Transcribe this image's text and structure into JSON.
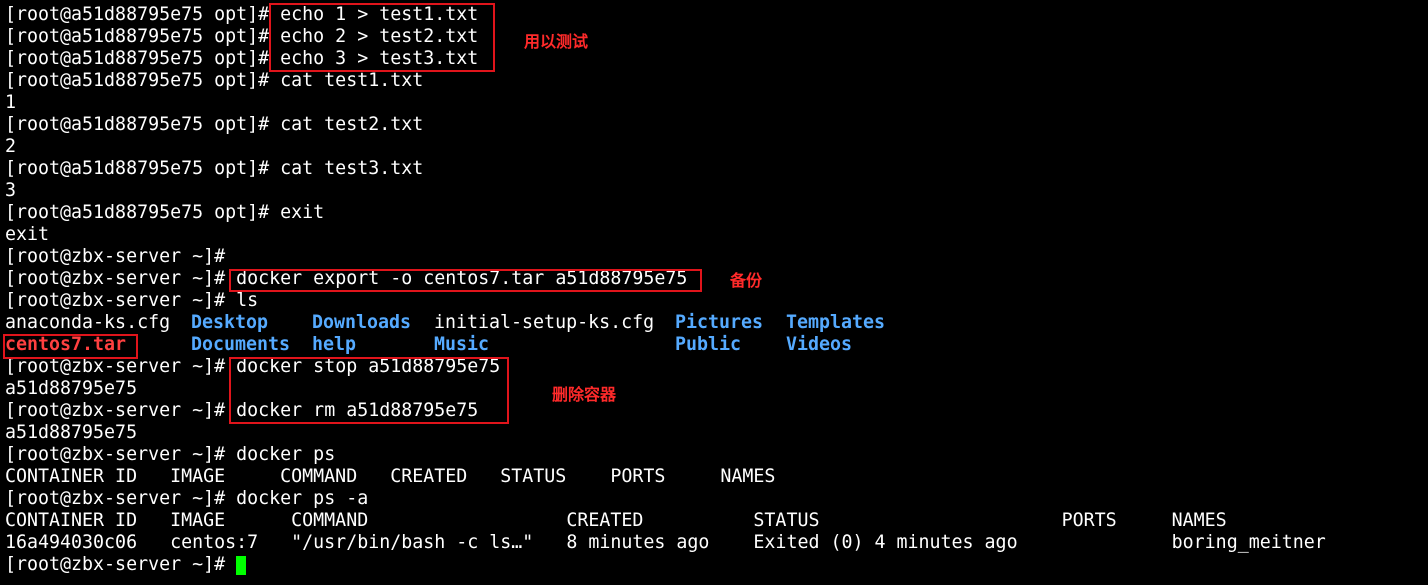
{
  "prompt_opt": "[root@a51d88795e75 opt]# ",
  "prompt_home": "[root@zbx-server ~]# ",
  "lines": [
    {
      "cmd": "echo 1 > test1.txt"
    },
    {
      "cmd": "echo 2 > test2.txt"
    },
    {
      "cmd": "echo 3 > test3.txt"
    },
    {
      "cmd": "cat test1.txt"
    },
    {
      "out": "1"
    },
    {
      "cmd": "cat test2.txt"
    },
    {
      "out": "2"
    },
    {
      "cmd": "cat test3.txt"
    },
    {
      "out": "3"
    },
    {
      "cmd": "exit"
    },
    {
      "out": "exit"
    },
    {
      "cmd": ""
    },
    {
      "cmd": "docker export -o centos7.tar a51d88795e75"
    },
    {
      "cmd": "ls"
    },
    {
      "cmd": "docker stop a51d88795e75"
    },
    {
      "out": "a51d88795e75"
    },
    {
      "cmd": "docker rm a51d88795e75"
    },
    {
      "out": "a51d88795e75"
    },
    {
      "cmd": "docker ps"
    },
    {
      "out": "CONTAINER ID   IMAGE     COMMAND   CREATED   STATUS    PORTS     NAMES"
    },
    {
      "cmd": "docker ps -a"
    },
    {
      "out": "CONTAINER ID   IMAGE      COMMAND                  CREATED          STATUS                      PORTS     NAMES"
    },
    {
      "out": "16a494030c06   centos:7   \"/usr/bin/bash -c ls…\"   8 minutes ago    Exited (0) 4 minutes ago              boring_meitner"
    },
    {
      "cmd": ""
    }
  ],
  "ls_output": {
    "row1": [
      "anaconda-ks.cfg",
      "Desktop",
      "Downloads",
      "initial-setup-ks.cfg",
      "Pictures",
      "Templates"
    ],
    "row2": [
      "centos7.tar",
      "Documents",
      "help",
      "Music",
      "Public",
      "Videos"
    ]
  },
  "annotations": {
    "test": "用以测试",
    "backup": "备份",
    "remove": "删除容器"
  },
  "colors": {
    "background": "#000000",
    "text": "#ffffff",
    "directory": "#55aaff",
    "archive": "#ff4040",
    "annotation": "#e0141b",
    "cursor": "#00ff00"
  }
}
